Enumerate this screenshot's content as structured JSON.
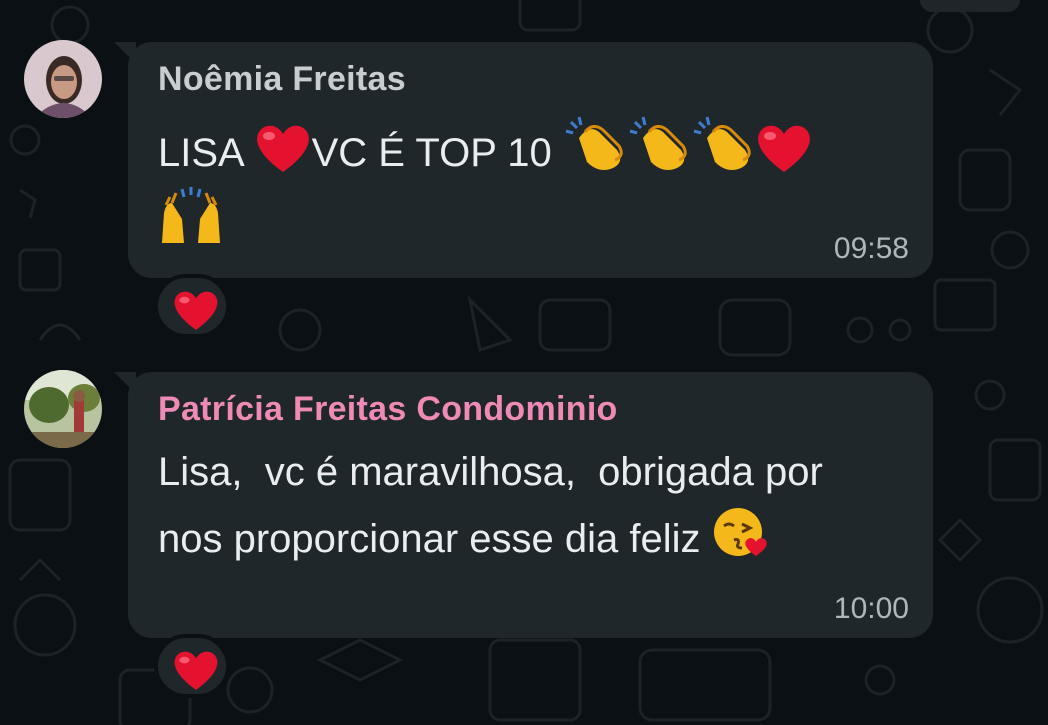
{
  "colors": {
    "background": "#0b1014",
    "bubble": "#1f272a",
    "message_text": "#e9edef",
    "time_text": "#aeb7bb",
    "sender1": "#c8cdd0",
    "sender2": "#ee8ab5",
    "heart": "#e5122f"
  },
  "messages": [
    {
      "sender": "Noêmia Freitas",
      "text_parts": [
        "LISA ",
        "VC É TOP 10 "
      ],
      "time": "09:58",
      "reaction": "heart-icon"
    },
    {
      "sender": "Patrícia Freitas Condominio",
      "text_line1": "Lisa,  vc é maravilhosa,  obrigada por",
      "text_line2": "nos proporcionar esse dia feliz ",
      "time": "10:00",
      "reaction": "heart-icon"
    }
  ]
}
